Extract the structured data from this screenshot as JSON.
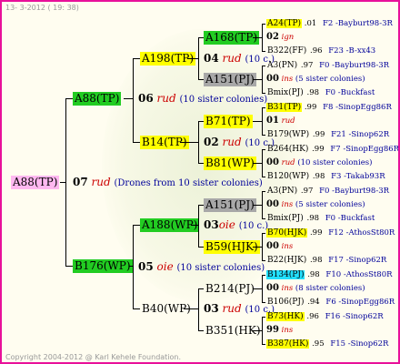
{
  "header": "13-  3-2012 ( 19: 38)",
  "footer": "Copyright 2004-2012 @ Karl Kehele Foundation.",
  "root": {
    "label": "A88(TP)",
    "num": "07",
    "rud": "rud",
    "note": "(Drones from 10 sister colonies)"
  },
  "gen1": [
    {
      "label": "A88(TP)",
      "num": "06",
      "rud": "rud",
      "note": "(10 sister colonies)"
    },
    {
      "label": "B176(WP)",
      "num": "05",
      "rud": "oie",
      "note": "(10 sister colonies)"
    }
  ],
  "gen2": [
    {
      "label": "A198(TP)",
      "num": "04",
      "rud": "rud",
      "note": "(10 c.)"
    },
    {
      "label": "B14(TP)",
      "num": "02",
      "rud": "rud",
      "note": "(10 c.)"
    },
    {
      "label": "A188(WP)",
      "num": "03",
      "rud": "oie",
      "note": "(10 c.)"
    },
    {
      "label": "B40(WP)",
      "num": "03",
      "rud": "rud",
      "note": "(10 c.)"
    }
  ],
  "gen3": [
    {
      "label": "A168(TP)"
    },
    {
      "label": "A151(PJ)"
    },
    {
      "label": "B71(TP)"
    },
    {
      "label": "B81(WP)"
    },
    {
      "label": "A151(PJ)"
    },
    {
      "label": "B59(HJK)"
    },
    {
      "label": "B214(PJ)"
    },
    {
      "label": "B351(HK)"
    }
  ],
  "leaves": [
    {
      "a": "A24(TP)",
      "an": ".01",
      "as": "F2 -Bayburt98-3R",
      "n": "02",
      "r": "ign",
      "c": "",
      "b": "B322(FF)",
      "bn": ".96",
      "bs": "F23 -B-xx43"
    },
    {
      "a": "A3(PN)",
      "an": ".97",
      "as": "F0 -Bayburt98-3R",
      "n": "00",
      "r": "ins",
      "c": "(5 sister colonies)",
      "b": "Bmix(PJ)",
      "bn": ".98",
      "bs": "F0 -Buckfast"
    },
    {
      "a": "B31(TP)",
      "an": ".99",
      "as": "F8 -SinopEgg86R",
      "n": "01",
      "r": "rud",
      "c": "",
      "b": "B179(WP)",
      "bn": ".99",
      "bs": "F21 -Sinop62R"
    },
    {
      "a": "B264(HK)",
      "an": ".99",
      "as": "F7 -SinopEgg86R",
      "n": "00",
      "r": "rud",
      "c": "(10 sister colonies)",
      "b": "B120(WP)",
      "bn": ".98",
      "bs": "F3 -Takab93R"
    },
    {
      "a": "A3(PN)",
      "an": ".97",
      "as": "F0 -Bayburt98-3R",
      "n": "00",
      "r": "ins",
      "c": "(5 sister colonies)",
      "b": "Bmix(PJ)",
      "bn": ".98",
      "bs": "F0 -Buckfast"
    },
    {
      "a": "B70(HJK)",
      "an": ".99",
      "as": "F12 -AthosSt80R",
      "n": "00",
      "r": "ins",
      "c": "",
      "b": "B22(HJK)",
      "bn": ".98",
      "bs": "F17 -Sinop62R"
    },
    {
      "a": "B134(PJ)",
      "an": ".98",
      "as": "F10 -AthosSt80R",
      "n": "00",
      "r": "ins",
      "c": "(8 sister colonies)",
      "b": "B106(PJ)",
      "bn": ".94",
      "bs": "F6 -SinopEgg86R"
    },
    {
      "a": "B73(HK)",
      "an": ".96",
      "as": "F16 -Sinop62R",
      "n": "99",
      "r": "ins",
      "c": "",
      "b": "B387(HK)",
      "bn": ".95",
      "bs": "F15 -Sinop62R"
    }
  ],
  "colors": {
    "border": "#e8109a",
    "green": "#22cc22",
    "yellow": "#ffff00",
    "pink": "#ffb8f0",
    "gray": "#a8a8a8",
    "cyan": "#22e0ff"
  }
}
